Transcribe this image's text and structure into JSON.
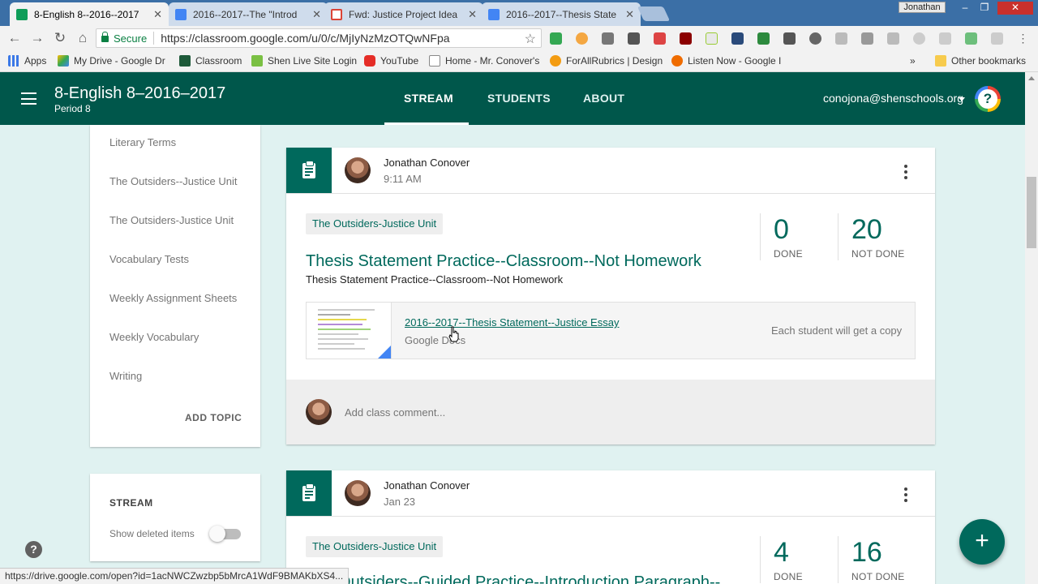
{
  "browser": {
    "tabs": [
      {
        "title": "8-English 8--2016--2017",
        "active": true
      },
      {
        "title": "2016--2017--The \"Introd",
        "active": false
      },
      {
        "title": "Fwd: Justice Project Idea",
        "active": false
      },
      {
        "title": "2016--2017--Thesis State",
        "active": false
      }
    ],
    "profile_name": "Jonathan",
    "secure_label": "Secure",
    "url": "https://classroom.google.com/u/0/c/MjIyNzMzOTQwNFpa",
    "bookmarks": [
      {
        "label": "Apps"
      },
      {
        "label": "My Drive - Google Dr"
      },
      {
        "label": "Classroom"
      },
      {
        "label": "Shen Live Site Login"
      },
      {
        "label": "YouTube"
      },
      {
        "label": "Home - Mr. Conover's"
      },
      {
        "label": "ForAllRubrics | Design"
      },
      {
        "label": "Listen Now - Google I"
      }
    ],
    "bookmarks_more": "»",
    "other_bookmarks": "Other bookmarks",
    "status_url": "https://drive.google.com/open?id=1acNWCZwzbp5bMrcA1WdF9BMAKbXS4..."
  },
  "header": {
    "class_name": "8-English 8–2016–2017",
    "section": "Period 8",
    "nav": {
      "stream": "STREAM",
      "students": "STUDENTS",
      "about": "ABOUT"
    },
    "account": "conojona@shenschools.org"
  },
  "sidebar": {
    "topics": [
      "Literary Terms",
      "The Outsiders--Justice Unit",
      "The Outsiders-Justice Unit",
      "Vocabulary Tests",
      "Weekly Assignment Sheets",
      "Weekly Vocabulary",
      "Writing"
    ],
    "add_topic": "ADD TOPIC",
    "stream_heading": "STREAM",
    "show_deleted": "Show deleted items",
    "show_deleted_on": false
  },
  "posts": [
    {
      "author": "Jonathan Conover",
      "time": "9:11 AM",
      "topic": "The Outsiders-Justice Unit",
      "title": "Thesis Statement Practice--Classroom--Not Homework",
      "description": "Thesis Statement Practice--Classroom--Not Homework",
      "done": "0",
      "done_label": "DONE",
      "not_done": "20",
      "not_done_label": "NOT DONE",
      "attachment": {
        "title": "2016--2017--Thesis Statement--Justice Essay",
        "type": "Google Docs",
        "note": "Each student will get a copy"
      },
      "comment_placeholder": "Add class comment..."
    },
    {
      "author": "Jonathan Conover",
      "time": "Jan 23",
      "topic": "The Outsiders-Justice Unit",
      "title": "The Outsiders--Guided Practice--Introduction Paragraph--",
      "done": "4",
      "done_label": "DONE",
      "not_done": "16",
      "not_done_label": "NOT DONE"
    }
  ],
  "colors": {
    "header": "#00574b",
    "accent": "#00695c",
    "background": "#e0f2f1"
  }
}
